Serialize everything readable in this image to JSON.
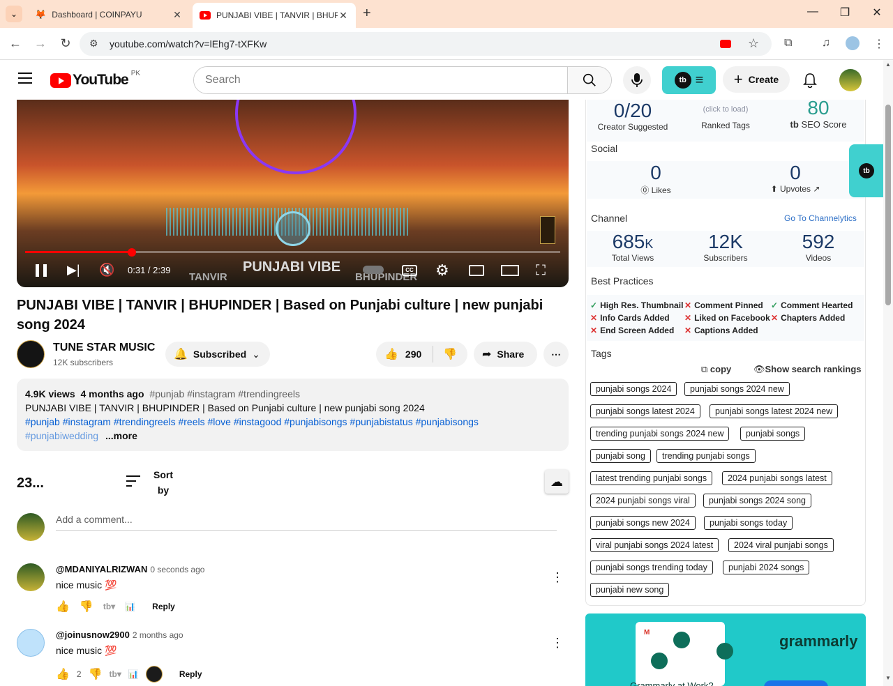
{
  "browser": {
    "tabs": [
      {
        "title": "Dashboard | COINPAYU"
      },
      {
        "title": "PUNJABI VIBE | TANVIR | BHUPINDER"
      }
    ],
    "url": "youtube.com/watch?v=lEhg7-tXFKw"
  },
  "header": {
    "logo_text": "YouTube",
    "region": "PK",
    "search_placeholder": "Search",
    "create_label": "Create"
  },
  "video": {
    "overlay_title": "PUNJABI VIBE",
    "overlay_left": "TANVIR",
    "overlay_right": "BHUPINDER",
    "time": "0:31 / 2:39",
    "progress": 0.2,
    "title": "PUNJABI VIBE | TANVIR | BHUPINDER | Based on Punjabi culture | new punjabi song 2024"
  },
  "channel": {
    "name": "TUNE STAR MUSIC",
    "subscribers": "12K subscribers",
    "subscribe_label": "Subscribed",
    "likes": "290",
    "share_label": "Share"
  },
  "description": {
    "views": "4.9K views",
    "age": "4 months ago",
    "hashtags_top": "#punjab #instagram #trendingreels",
    "line1": "PUNJABI VIBE | TANVIR | BHUPINDER | Based on Punjabi culture | new punjabi song 2024",
    "line2": "#punjab #instagram #trendingreels #reels #love #instagood #punjabisongs #punjabistatus #punjabisongs",
    "line3": "#punjabiwedding",
    "more": "...more"
  },
  "comments": {
    "count": "23...",
    "sort_label_1": "Sort",
    "sort_label_2": "by",
    "add_placeholder": "Add a comment...",
    "items": [
      {
        "user": "@MDANIYALRIZWAN",
        "time": "0 seconds ago",
        "text": "nice music 💯",
        "likes": "",
        "reply": "Reply"
      },
      {
        "user": "@joinusnow2900",
        "time": "2 months ago",
        "text": "nice music 💯",
        "likes": "2",
        "reply": "Reply"
      }
    ]
  },
  "panel": {
    "top": [
      {
        "value": "0/20",
        "label": "Creator Suggested"
      },
      {
        "value": "(click to load)",
        "label": "Ranked Tags"
      },
      {
        "value": "80",
        "label": "SEO Score"
      }
    ],
    "social_title": "Social",
    "social": [
      {
        "value": "0",
        "label": "Likes"
      },
      {
        "value": "0",
        "label": "Upvotes"
      }
    ],
    "channel_title": "Channel",
    "channel_link": "Go To Channelytics",
    "channel_stats": [
      {
        "value": "685",
        "suffix": "K",
        "label": "Total Views"
      },
      {
        "value": "12K",
        "suffix": "",
        "label": "Subscribers"
      },
      {
        "value": "592",
        "suffix": "",
        "label": "Videos"
      }
    ],
    "practices_title": "Best Practices",
    "practices": [
      {
        "label": "High Res. Thumbnail",
        "ok": true
      },
      {
        "label": "Comment Pinned",
        "ok": false
      },
      {
        "label": "Comment Hearted",
        "ok": true
      },
      {
        "label": "Info Cards Added",
        "ok": false
      },
      {
        "label": "Liked on Facebook",
        "ok": false
      },
      {
        "label": "Chapters Added",
        "ok": false
      },
      {
        "label": "End Screen Added",
        "ok": false
      },
      {
        "label": "Captions Added",
        "ok": false
      }
    ],
    "tags_title": "Tags",
    "copy_label": "copy",
    "rankings_label": "Show search rankings",
    "tags": [
      "punjabi songs 2024",
      "punjabi songs 2024 new",
      "punjabi songs latest 2024",
      "punjabi songs latest 2024 new",
      "trending punjabi songs 2024 new",
      "punjabi songs",
      "punjabi song",
      "trending punjabi songs",
      "latest trending punjabi songs",
      "2024 punjabi songs latest",
      "2024 punjabi songs viral",
      "punjabi songs 2024 song",
      "punjabi songs new 2024",
      "punjabi songs today",
      "viral punjabi songs 2024 latest",
      "2024 viral punjabi songs",
      "punjabi songs trending today",
      "punjabi 2024 songs",
      "punjabi new song"
    ]
  },
  "ad": {
    "brand": "grammarly",
    "bottom_text": "Grammarly at Work?"
  },
  "colors": {
    "youtube_red": "#ff0000",
    "tubebuddy_teal": "#40d0cf",
    "stat_blue": "#1c3a67",
    "seo_green": "#2a9d8f",
    "link_blue": "#065fd4"
  }
}
